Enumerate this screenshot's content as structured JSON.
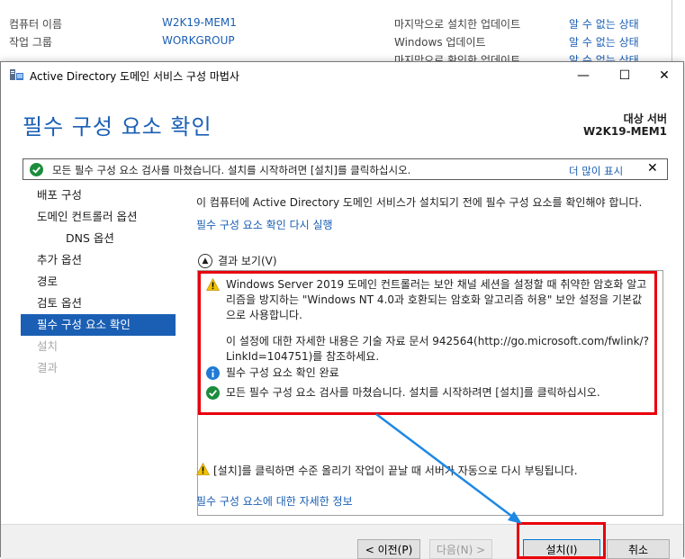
{
  "background": {
    "rows": [
      {
        "label": "컴퓨터 이름",
        "value": "W2K19-MEM1",
        "label2": "마지막으로 설치한 업데이트",
        "value2": "알 수 없는 상태"
      },
      {
        "label": "작업 그룹",
        "value": "WORKGROUP",
        "label2": "Windows 업데이트",
        "value2": "알 수 없는 상태"
      },
      {
        "label": "",
        "value": "",
        "label2": "마지막으로 확인한 업데이트",
        "value2": "알 수 없는 상태"
      }
    ]
  },
  "window": {
    "title": "Active Directory 도메인 서비스 구성 마법사",
    "minimize": "—",
    "maximize": "☐",
    "close": "✕"
  },
  "header": {
    "page_title": "필수 구성 요소 확인",
    "target_label": "대상 서버",
    "target_name": "W2K19-MEM1"
  },
  "notification": {
    "message": "모든 필수 구성 요소 검사를 마쳤습니다. 설치를 시작하려면 [설치]를 클릭하십시오.",
    "more": "더 많이 표시",
    "close": "✕"
  },
  "nav": {
    "items": [
      {
        "label": "배포 구성"
      },
      {
        "label": "도메인 컨트롤러 옵션"
      },
      {
        "label": "DNS 옵션"
      },
      {
        "label": "추가 옵션"
      },
      {
        "label": "경로"
      },
      {
        "label": "검토 옵션"
      },
      {
        "label": "필수 구성 요소 확인"
      },
      {
        "label": "설치"
      },
      {
        "label": "결과"
      }
    ]
  },
  "content": {
    "intro": "이 컴퓨터에 Active Directory 도메인 서비스가 설치되기 전에 필수 구성 요소를 확인해야 합니다.",
    "rerun": "필수 구성 요소 확인 다시 실행",
    "results_toggle": "결과 보기(V)",
    "results": [
      {
        "icon": "warning",
        "text": "Windows Server 2019 도메인 컨트롤러는 보안 채널 세션을 설정할 때 취약한 암호화 알고리즘을 방지하는 \"Windows NT 4.0과 호환되는 암호화 알고리즘 허용\" 보안 설정을 기본값으로 사용합니다."
      },
      {
        "icon": "",
        "text": "이 설정에 대한 자세한 내용은 기술 자료 문서 942564(http://go.microsoft.com/fwlink/?LinkId=104751)를 참조하세요."
      },
      {
        "icon": "info",
        "text": "필수 구성 요소 확인 완료"
      },
      {
        "icon": "ok",
        "text": "모든 필수 구성 요소 검사를 마쳤습니다. 설치를 시작하려면 [설치]를 클릭하십시오."
      }
    ],
    "bottom_warning": "[설치]를 클릭하면 수준 올리기 작업이 끝날 때 서버가 자동으로 다시 부팅됩니다.",
    "more_info": "필수 구성 요소에 대한 자세한 정보"
  },
  "footer": {
    "prev": "< 이전(P)",
    "next": "다음(N) >",
    "install": "설치(I)",
    "cancel": "취소"
  },
  "colors": {
    "accent": "#1a5fb4",
    "highlight": "#e8000b",
    "arrow": "#1e88e5"
  }
}
